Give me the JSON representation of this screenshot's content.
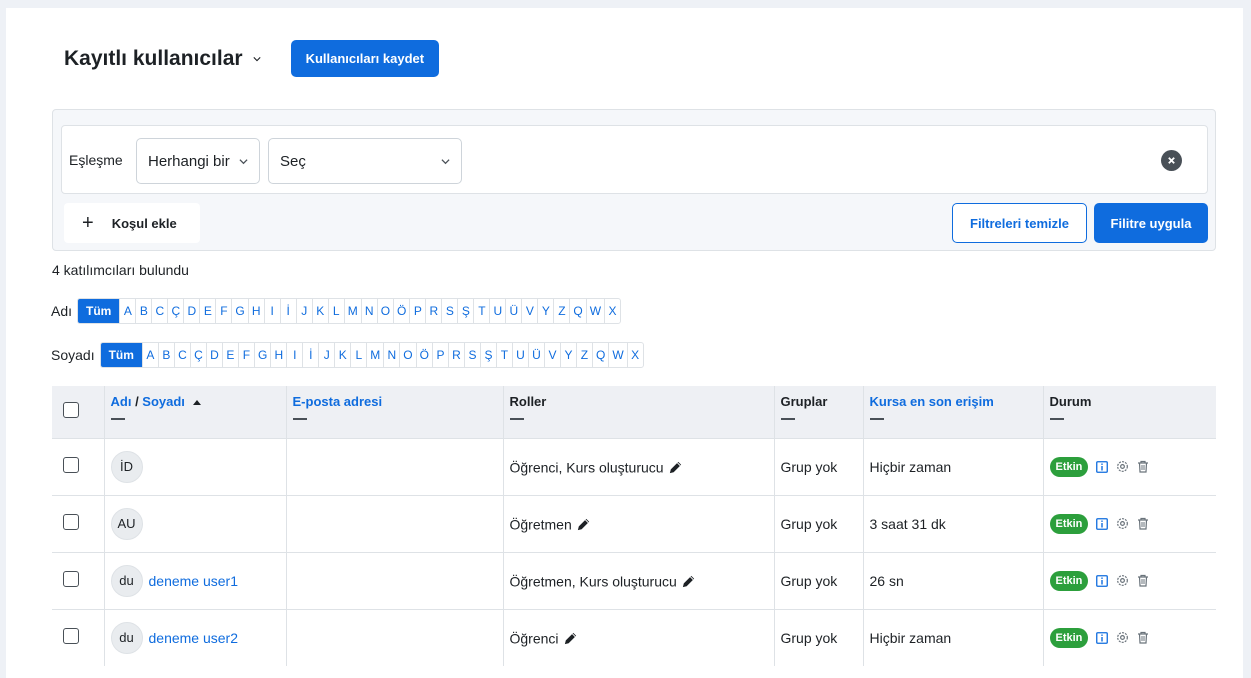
{
  "header": {
    "title": "Kayıtlı kullanıcılar",
    "save_label": "Kullanıcıları kaydet"
  },
  "filter": {
    "match_label": "Eşleşme",
    "match_value": "Herhangi bir",
    "field_value": "Seç",
    "add_condition": "Koşul ekle",
    "clear_label": "Filtreleri temizle",
    "apply_label": "Filitre uygula"
  },
  "found_text": "4 katılımcıları bulundu",
  "alpha": {
    "first_label": "Adı",
    "last_label": "Soyadı",
    "all": "Tüm",
    "letters": [
      "A",
      "B",
      "C",
      "Ç",
      "D",
      "E",
      "F",
      "G",
      "H",
      "I",
      "İ",
      "J",
      "K",
      "L",
      "M",
      "N",
      "O",
      "Ö",
      "P",
      "R",
      "S",
      "Ş",
      "T",
      "U",
      "Ü",
      "V",
      "Y",
      "Z",
      "Q",
      "W",
      "X"
    ]
  },
  "table": {
    "headers": {
      "name_first": "Adı",
      "slash": " / ",
      "name_last": "Soyadı",
      "email": "E-posta adresi",
      "roles": "Roller",
      "groups": "Gruplar",
      "last_access": "Kursa en son erişim",
      "status": "Durum"
    },
    "rows": [
      {
        "initials": "İD",
        "name": "",
        "roles": "Öğrenci, Kurs oluşturucu",
        "groups": "Grup yok",
        "last_access": "Hiçbir zaman",
        "status": "Etkin"
      },
      {
        "initials": "AU",
        "name": "",
        "roles": "Öğretmen",
        "groups": "Grup yok",
        "last_access": "3 saat 31 dk",
        "status": "Etkin"
      },
      {
        "initials": "du",
        "name": "deneme user1",
        "roles": "Öğretmen, Kurs oluşturucu",
        "groups": "Grup yok",
        "last_access": "26 sn",
        "status": "Etkin"
      },
      {
        "initials": "du",
        "name": "deneme user2",
        "roles": "Öğrenci",
        "groups": "Grup yok",
        "last_access": "Hiçbir zaman",
        "status": "Etkin"
      }
    ]
  },
  "colors": {
    "primary": "#0f6cde",
    "success": "#2c9f3c"
  }
}
